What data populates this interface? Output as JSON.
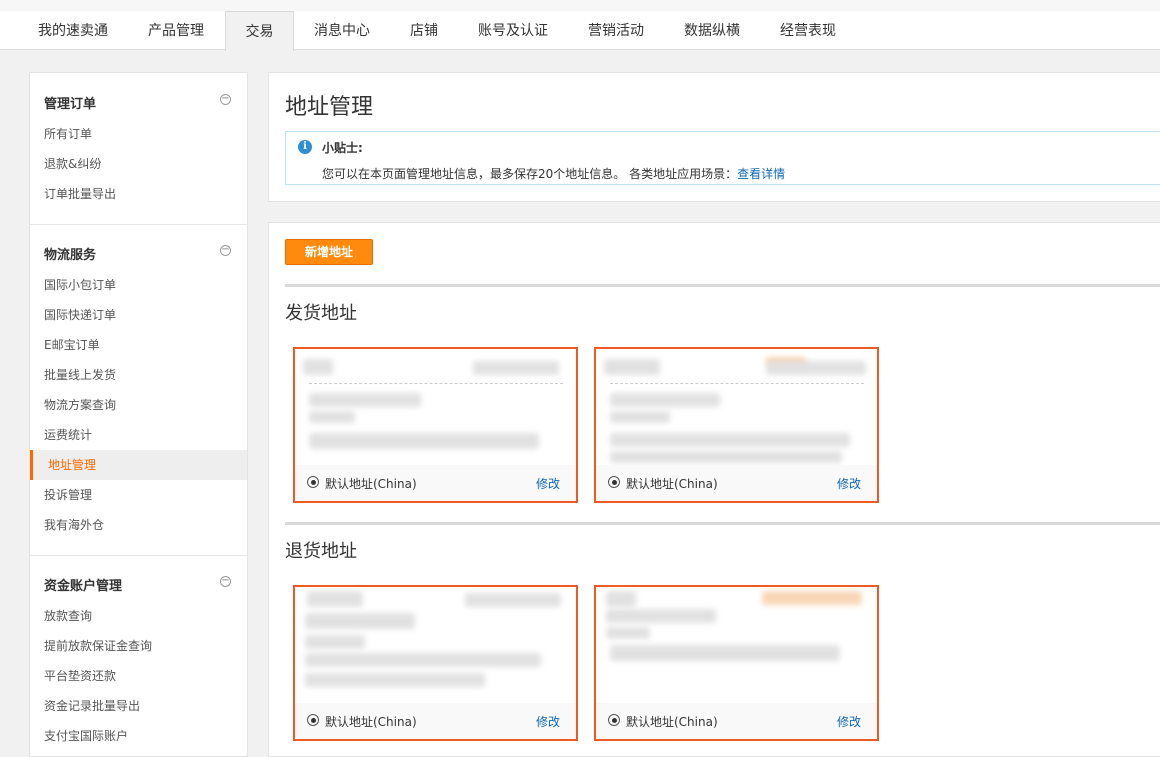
{
  "topnav": {
    "tabs": [
      {
        "label": "我的速卖通"
      },
      {
        "label": "产品管理"
      },
      {
        "label": "交易"
      },
      {
        "label": "消息中心"
      },
      {
        "label": "店铺"
      },
      {
        "label": "账号及认证"
      },
      {
        "label": "营销活动"
      },
      {
        "label": "数据纵横"
      },
      {
        "label": "经营表现"
      }
    ],
    "active_tab": "交易"
  },
  "sidebar": {
    "sections": [
      {
        "title": "管理订单",
        "toggle": "−",
        "items": [
          {
            "label": "所有订单"
          },
          {
            "label": "退款&纠纷"
          },
          {
            "label": "订单批量导出"
          }
        ]
      },
      {
        "title": "物流服务",
        "toggle": "−",
        "items": [
          {
            "label": "国际小包订单"
          },
          {
            "label": "国际快递订单"
          },
          {
            "label": "E邮宝订单"
          },
          {
            "label": "批量线上发货"
          },
          {
            "label": "物流方案查询"
          },
          {
            "label": "运费统计"
          },
          {
            "label": "地址管理"
          },
          {
            "label": "投诉管理"
          },
          {
            "label": "我有海外仓"
          }
        ]
      },
      {
        "title": "资金账户管理",
        "toggle": "−",
        "items": [
          {
            "label": "放款查询"
          },
          {
            "label": "提前放款保证金查询"
          },
          {
            "label": "平台垫资还款"
          },
          {
            "label": "资金记录批量导出"
          },
          {
            "label": "支付宝国际账户"
          }
        ]
      }
    ],
    "active_item": "地址管理"
  },
  "page": {
    "title": "地址管理",
    "tip_title": "小贴士:",
    "tip_text": "您可以在本页面管理地址信息，最多保存20个地址信息。 各类地址应用场景：",
    "tip_link": "查看详情",
    "add_button": "新增地址"
  },
  "groups": [
    {
      "title": "发货地址",
      "cards": [
        {
          "default_label": "默认地址(China)",
          "edit_label": "修改"
        },
        {
          "default_label": "默认地址(China)",
          "edit_label": "修改"
        }
      ]
    },
    {
      "title": "退货地址",
      "cards": [
        {
          "default_label": "默认地址(China)",
          "edit_label": "修改"
        },
        {
          "default_label": "默认地址(China)",
          "edit_label": "修改"
        }
      ]
    }
  ],
  "colors": {
    "accent": "#ff6a00",
    "button": "#ff8a0e",
    "card_border": "#ee5a24",
    "link": "#0e66b7",
    "info": "#2d8ed3"
  }
}
